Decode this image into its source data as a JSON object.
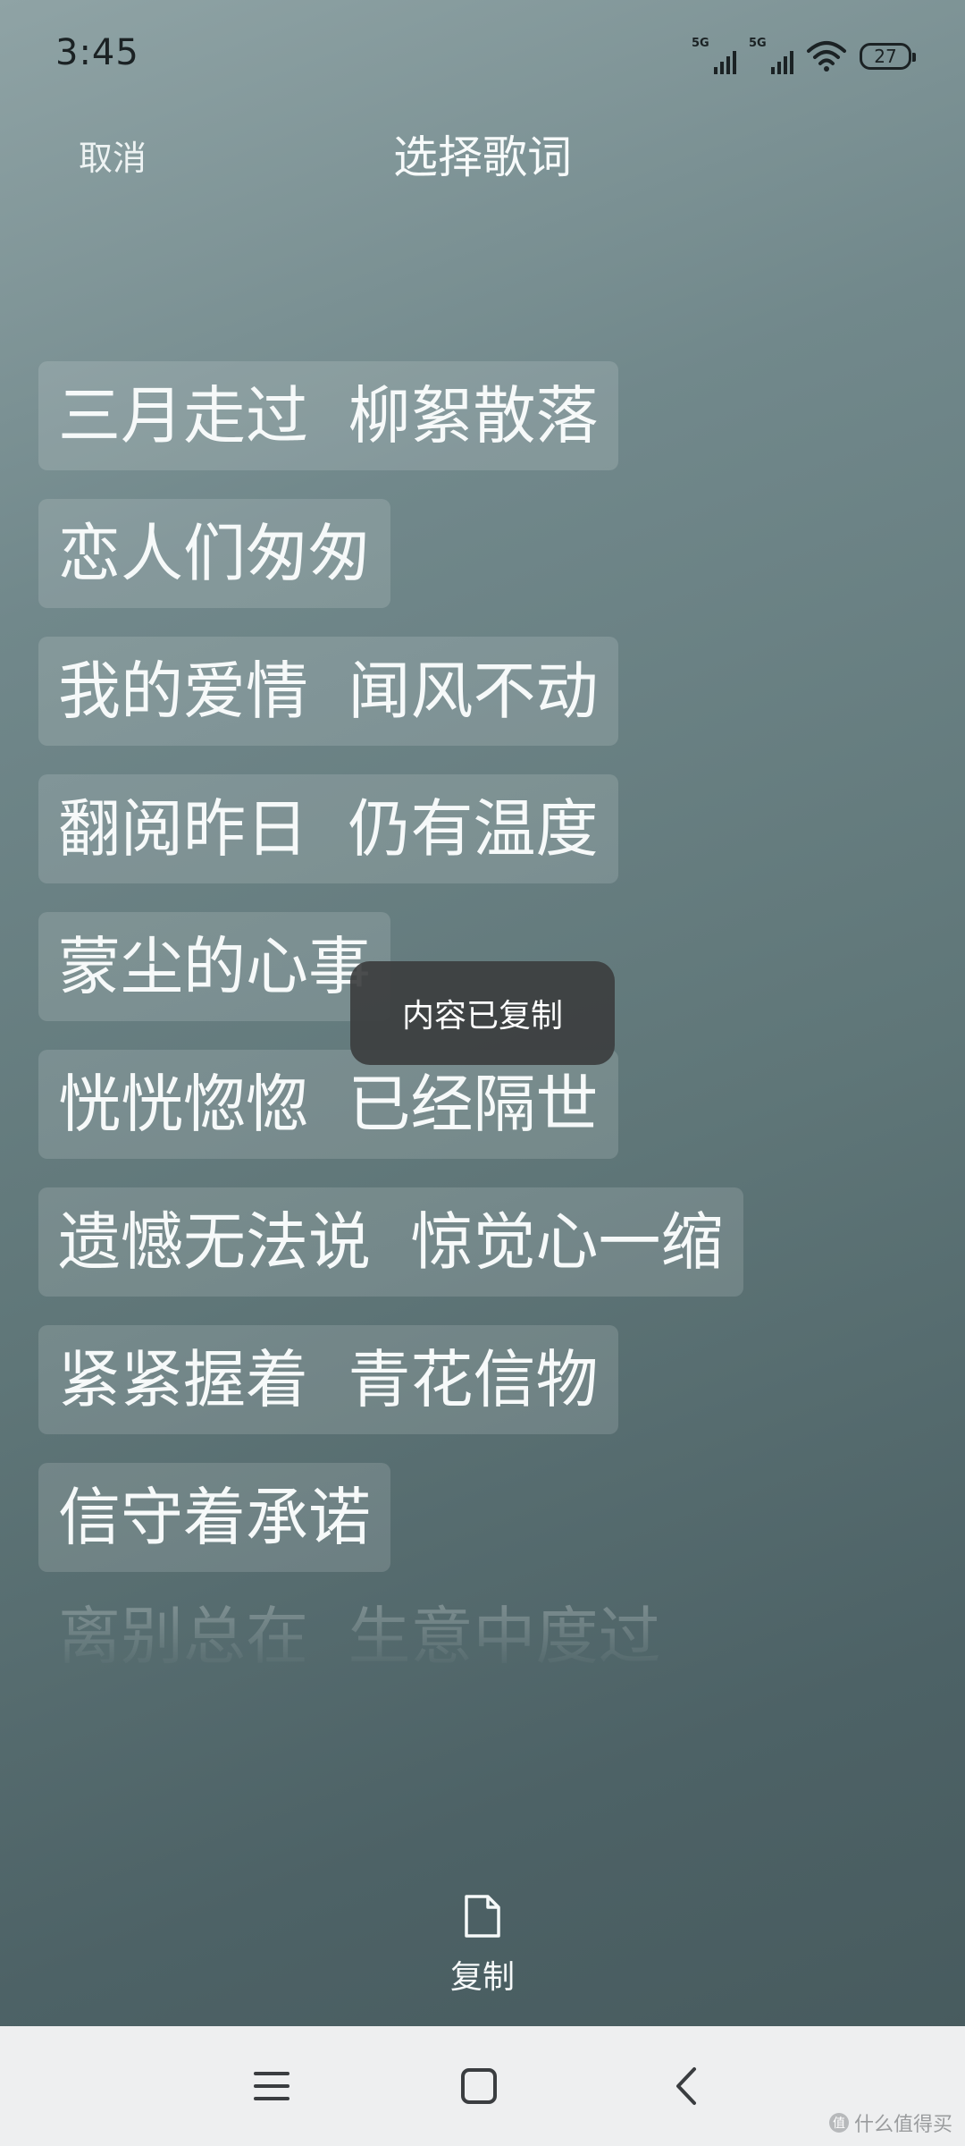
{
  "status_bar": {
    "time": "3:45",
    "sim1_tag": "5G",
    "sim2_tag": "5G",
    "battery": "27"
  },
  "header": {
    "cancel_label": "取消",
    "title": "选择歌词"
  },
  "lyrics": [
    "三月走过  柳絮散落",
    "恋人们匆匆",
    "我的爱情  闻风不动",
    "翻阅昨日  仍有温度",
    "蒙尘的心事",
    "恍恍惚惚  已经隔世",
    "遗憾无法说  惊觉心一缩",
    "紧紧握着  青花信物",
    "信守着承诺",
    "离别总在  生意中度过"
  ],
  "toast": {
    "text": "内容已复制"
  },
  "actions": {
    "copy_label": "复制"
  },
  "watermark": {
    "badge": "值",
    "text": "什么值得买"
  },
  "colors": {
    "lyric_text": "#f6f9f9",
    "toast_bg": "#3c3e3f",
    "nav_bg": "#eeeff0"
  }
}
